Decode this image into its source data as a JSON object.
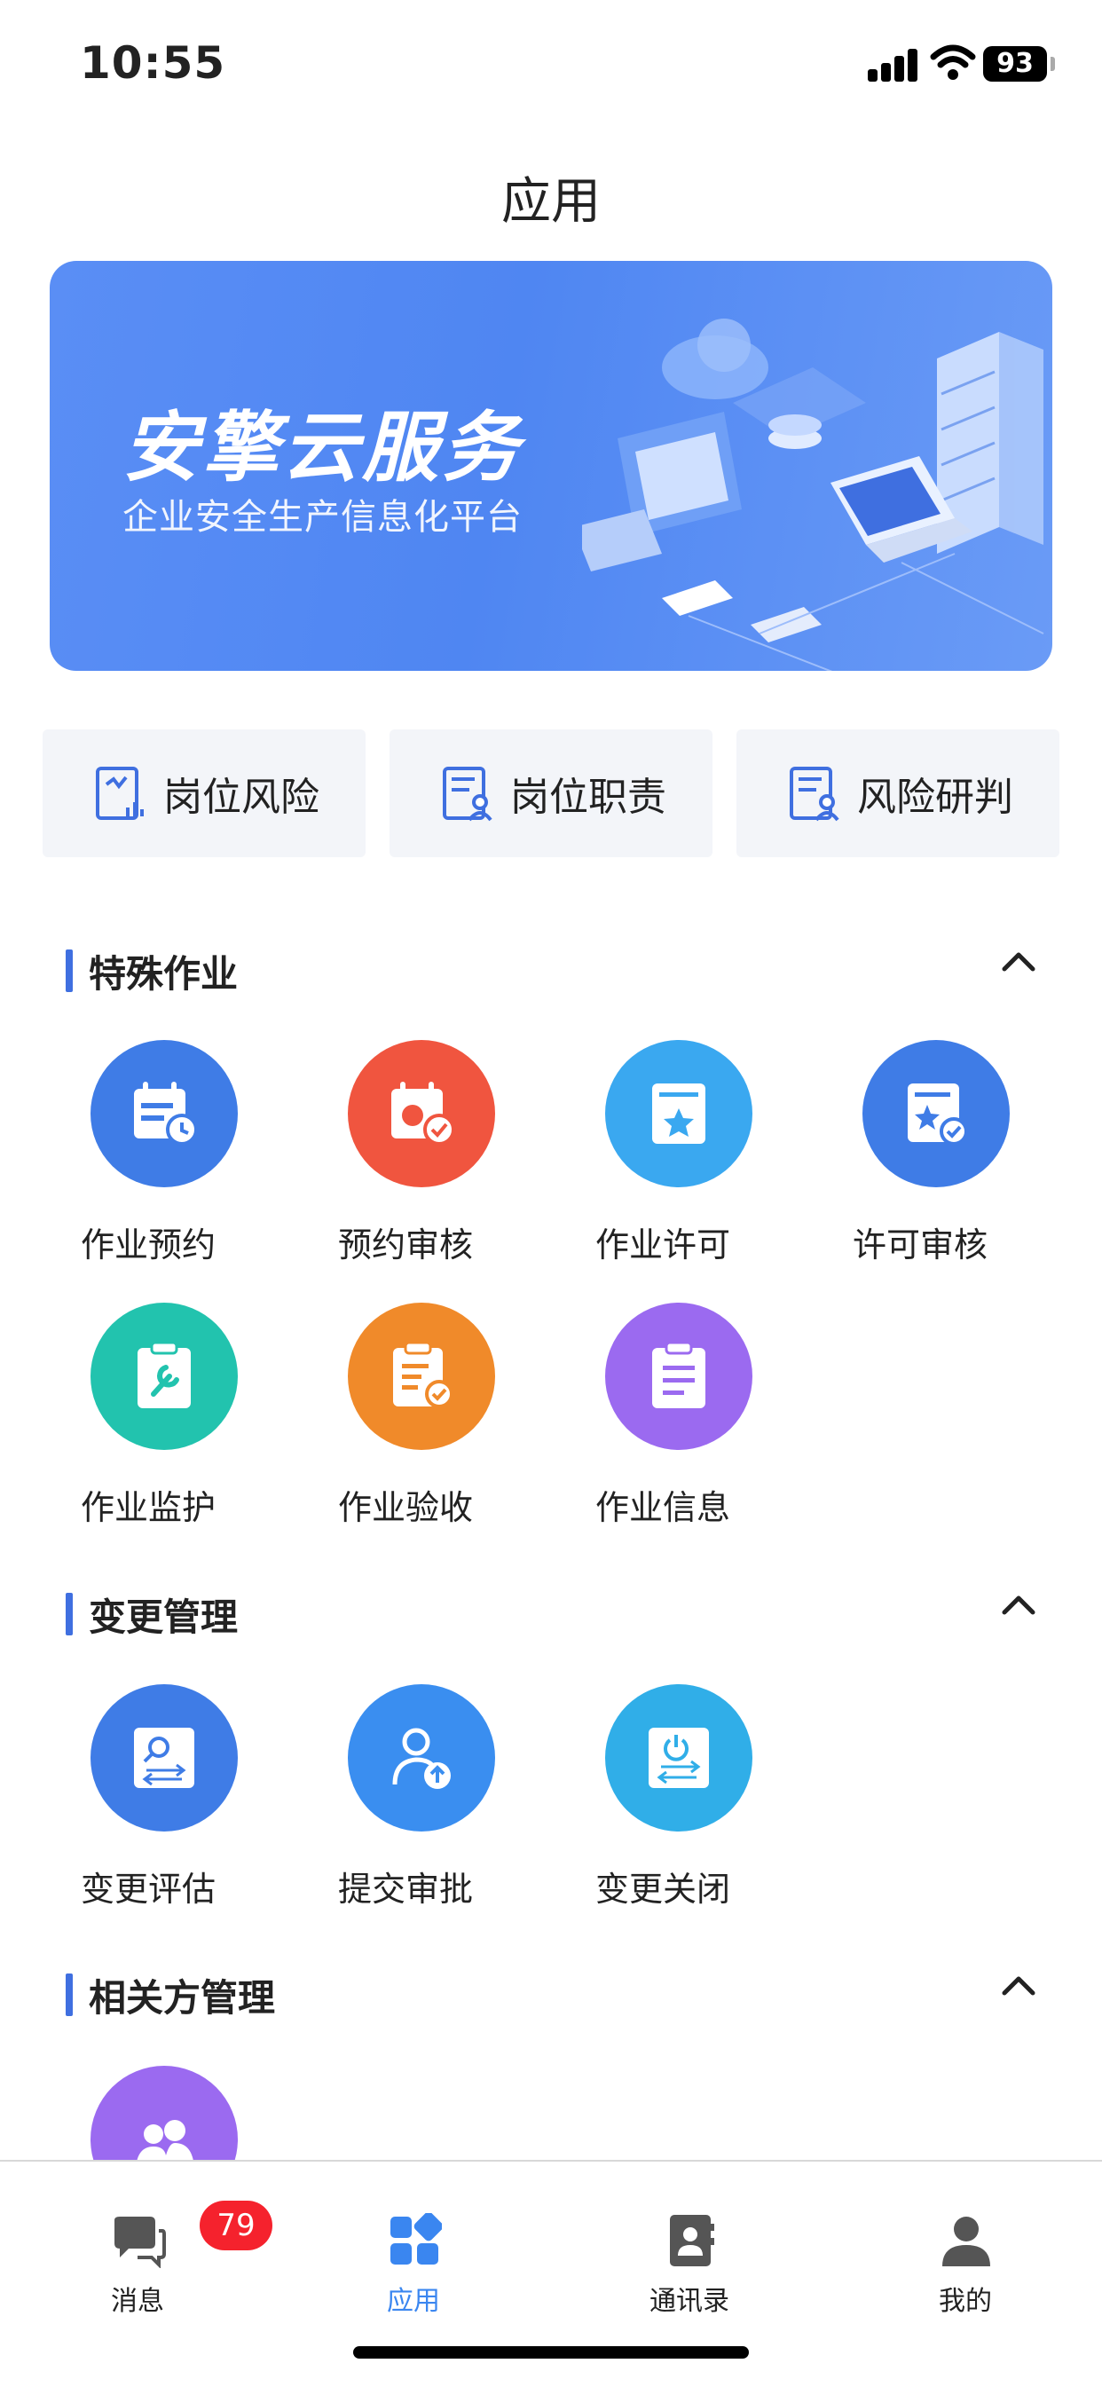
{
  "status": {
    "time": "10:55",
    "battery": "93"
  },
  "page": {
    "title": "应用"
  },
  "banner": {
    "title": "安擎云服务",
    "subtitle": "企业安全生产信息化平台"
  },
  "quick_links": [
    {
      "label": "岗位风险",
      "icon": "risk-chart-icon"
    },
    {
      "label": "岗位职责",
      "icon": "duty-person-icon"
    },
    {
      "label": "风险研判",
      "icon": "risk-review-icon"
    }
  ],
  "sections": [
    {
      "title": "特殊作业",
      "apps": [
        {
          "label": "作业预约",
          "icon": "calendar-clock-icon",
          "color": "#3f7ce6"
        },
        {
          "label": "预约审核",
          "icon": "calendar-check-icon",
          "color": "#f0553f"
        },
        {
          "label": "作业许可",
          "icon": "star-doc-icon",
          "color": "#3aa8f0"
        },
        {
          "label": "许可审核",
          "icon": "star-doc-check-icon",
          "color": "#3f7ce6"
        },
        {
          "label": "作业监护",
          "icon": "clipboard-wrench-icon",
          "color": "#22c3ae"
        },
        {
          "label": "作业验收",
          "icon": "clipboard-check-icon",
          "color": "#f08a2a"
        },
        {
          "label": "作业信息",
          "icon": "clipboard-list-icon",
          "color": "#9b6af0"
        }
      ]
    },
    {
      "title": "变更管理",
      "apps": [
        {
          "label": "变更评估",
          "icon": "search-exchange-icon",
          "color": "#3f7ce6"
        },
        {
          "label": "提交审批",
          "icon": "user-upload-icon",
          "color": "#3a8ef0"
        },
        {
          "label": "变更关闭",
          "icon": "power-exchange-icon",
          "color": "#30aee8"
        }
      ]
    },
    {
      "title": "相关方管理",
      "apps": [
        {
          "label": "",
          "icon": "group-users-icon",
          "color": "#9b6af0"
        }
      ]
    }
  ],
  "tabbar": {
    "items": [
      {
        "label": "消息",
        "icon": "chat-icon",
        "badge": "79"
      },
      {
        "label": "应用",
        "icon": "apps-icon"
      },
      {
        "label": "通讯录",
        "icon": "contacts-icon"
      },
      {
        "label": "我的",
        "icon": "person-icon"
      }
    ],
    "active_color": "#3a86f0"
  }
}
